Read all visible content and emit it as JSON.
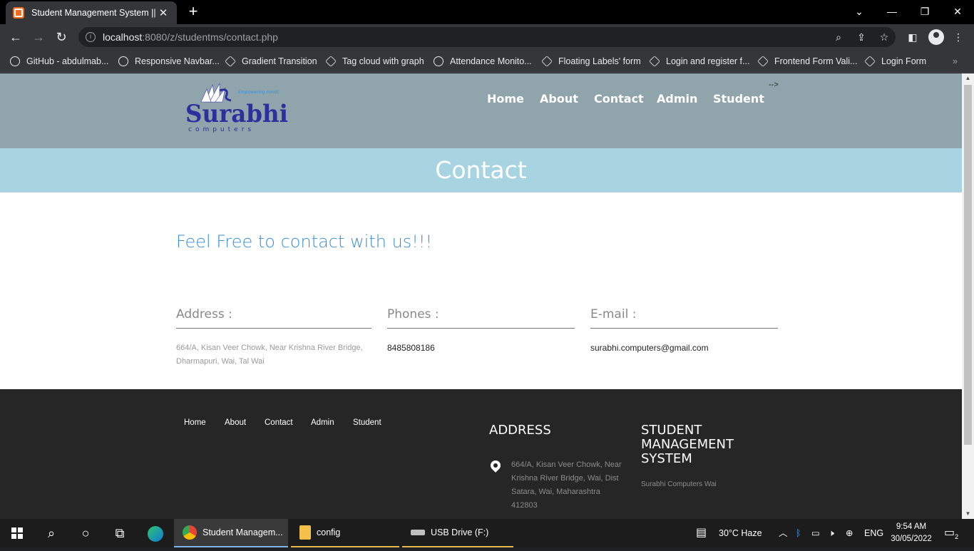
{
  "browser": {
    "tab_title": "Student Management System || C",
    "url_host": "localhost",
    "url_path": ":8080/z/studentms/contact.php",
    "bookmarks": [
      "GitHub - abdulmab...",
      "Responsive Navbar...",
      "Gradient Transition",
      "Tag cloud with graph",
      "Attendance Monito...",
      "Floating Labels' form",
      "Login and register f...",
      "Frontend Form Vali...",
      "Login Form"
    ],
    "bookmarks_overflow": "»"
  },
  "site": {
    "logo": {
      "tagline": "Empowering minds",
      "name": "Surabhi",
      "sub": "computers"
    },
    "nav": [
      "Home",
      "About",
      "Contact",
      "Admin",
      "Student"
    ],
    "stray_text": "-->",
    "banner_title": "Contact",
    "tagline": "Feel Free to contact with us!!!",
    "contact": {
      "address_label": "Address :",
      "address_line1": "664/A, Kisan Veer Chowk, Near Krishna River Bridge,",
      "address_line2": "Dharmapuri, Wai, Tal Wai",
      "phones_label": "Phones :",
      "phone": "8485808186",
      "email_label": "E-mail :",
      "email": "surabhi.computers@gmail.com"
    },
    "footer": {
      "links": [
        "Home",
        "About",
        "Contact",
        "Admin",
        "Student"
      ],
      "address_heading": "ADDRESS",
      "address_lines": [
        "664/A, Kisan Veer Chowk, Near",
        "Krishna River Bridge, Wai, Dist",
        "Satara, Wai, Maharashtra",
        "412803"
      ],
      "sms_heading_lines": [
        "STUDENT",
        "MANAGEMENT",
        "SYSTEM"
      ],
      "sms_sub": "Surabhi Computers Wai"
    }
  },
  "taskbar": {
    "apps": [
      "Student Managem...",
      "config",
      "USB Drive (F:)"
    ],
    "weather": "30°C  Haze",
    "language": "ENG",
    "time": "9:54 AM",
    "date": "30/05/2022",
    "notification_count": "2"
  }
}
